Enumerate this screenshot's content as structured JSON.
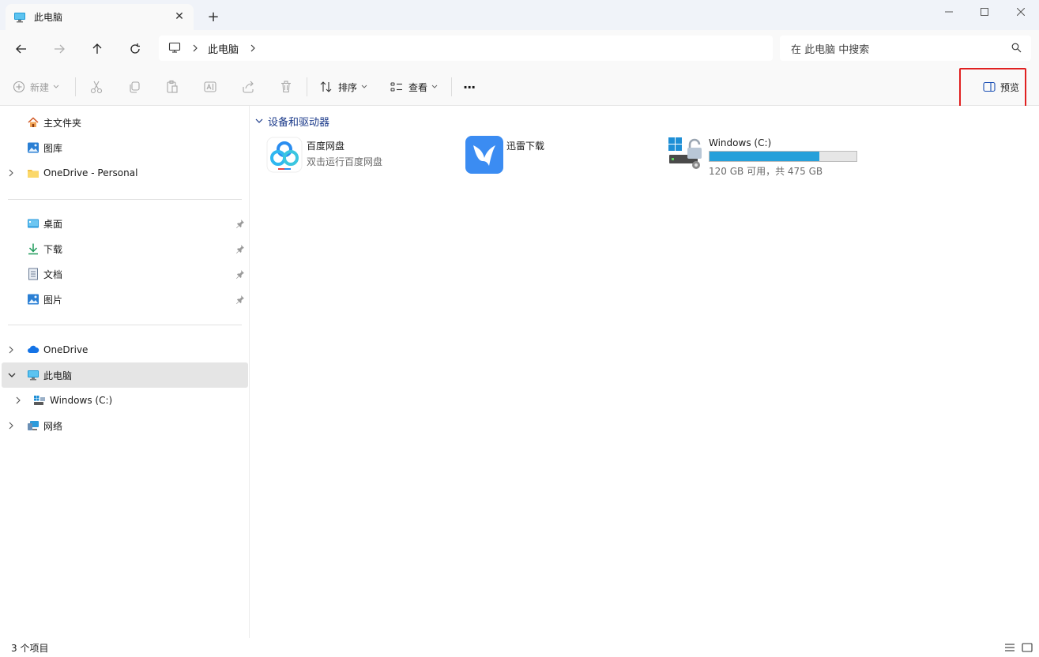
{
  "tab": {
    "title": "此电脑",
    "close": "✕",
    "new_tab": "+"
  },
  "window": {
    "minimize": "—",
    "maximize": "☐",
    "close": "✕"
  },
  "address": {
    "crumb": "此电脑"
  },
  "search": {
    "placeholder": "在 此电脑 中搜索"
  },
  "toolbar": {
    "new_label": "新建",
    "sort_label": "排序",
    "view_label": "查看",
    "more_label": "···",
    "preview_label": "预览"
  },
  "sidebar": {
    "home": "主文件夹",
    "gallery": "图库",
    "onedrive_personal": "OneDrive - Personal",
    "desktop": "桌面",
    "downloads": "下载",
    "documents": "文档",
    "pictures": "图片",
    "onedrive": "OneDrive",
    "this_pc": "此电脑",
    "windows_c": "Windows (C:)",
    "network": "网络"
  },
  "content": {
    "group_title": "设备和驱动器",
    "items": [
      {
        "name": "百度网盘",
        "sub": "双击运行百度网盘"
      },
      {
        "name": "迅雷下载",
        "sub": ""
      },
      {
        "name": "Windows (C:)",
        "sub": "120 GB 可用，共 475 GB",
        "used_fraction": 0.747
      }
    ]
  },
  "status": {
    "count": "3 个项目"
  },
  "colors": {
    "accent": "#26a0da",
    "highlight": "#e02020",
    "group_title": "#1b3a8a"
  }
}
